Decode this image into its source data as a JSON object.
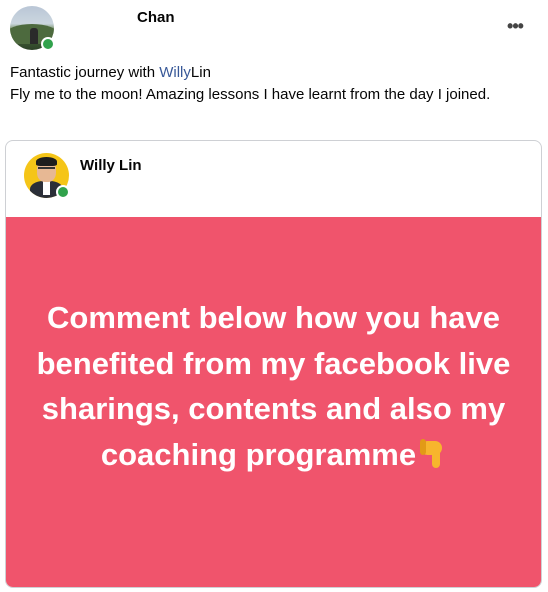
{
  "post": {
    "author": {
      "name": "Chan",
      "online": true
    },
    "more_options_icon": "more-horizontal-icon",
    "more_options_glyph": "•••",
    "text": {
      "line1_prefix": "Fantastic journey with ",
      "mention_first": "Willy",
      "mention_last": "Lin",
      "line2": "Fly me to the moon! Amazing lessons I have learnt from the day I joined."
    },
    "shared_post": {
      "author": {
        "name": "Willy Lin",
        "online": true
      },
      "banner": {
        "background_color": "#f0546c",
        "text": "Comment below how you have benefited from my facebook live sharings, contents and also my coaching programme",
        "emoji_icon": "backhand-index-pointing-down-icon"
      }
    },
    "colors": {
      "mention": "#385898",
      "online": "#31a24c",
      "banner": "#f0546c"
    }
  }
}
